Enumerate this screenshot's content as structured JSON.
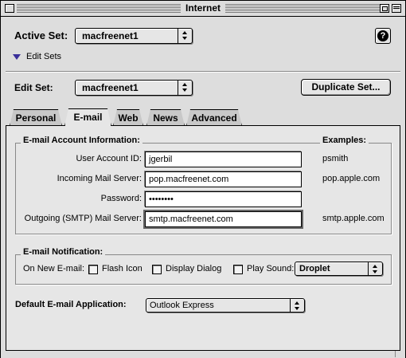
{
  "window": {
    "title": "Internet"
  },
  "header": {
    "active_set_label": "Active Set:",
    "active_set_value": "macfreenet1",
    "edit_sets_label": "Edit Sets",
    "edit_set_label": "Edit Set:",
    "edit_set_value": "macfreenet1",
    "duplicate_button": "Duplicate Set...",
    "help_icon": "?"
  },
  "tabs": [
    {
      "label": "Personal",
      "active": false
    },
    {
      "label": "E-mail",
      "active": true
    },
    {
      "label": "Web",
      "active": false
    },
    {
      "label": "News",
      "active": false
    },
    {
      "label": "Advanced",
      "active": false
    }
  ],
  "account": {
    "group_title": "E-mail Account Information:",
    "examples_title": "Examples:",
    "fields": [
      {
        "label": "User Account ID:",
        "value": "jgerbil",
        "example": "psmith"
      },
      {
        "label": "Incoming Mail Server:",
        "value": "pop.macfreenet.com",
        "example": "pop.apple.com"
      },
      {
        "label": "Password:",
        "value": "••••••••",
        "example": ""
      },
      {
        "label": "Outgoing (SMTP) Mail Server:",
        "value": "smtp.macfreenet.com",
        "example": "smtp.apple.com"
      }
    ]
  },
  "notification": {
    "group_title": "E-mail Notification:",
    "on_new_label": "On New E-mail:",
    "flash_icon": "Flash Icon",
    "display_dialog": "Display Dialog",
    "play_sound": "Play Sound:",
    "sound_value": "Droplet"
  },
  "default_app": {
    "label": "Default E-mail Application:",
    "value": "Outlook Express"
  },
  "icons": [
    "close-box-icon",
    "zoom-box-icon",
    "collapse-box-icon",
    "help-icon",
    "disclosure-triangle-icon",
    "popup-arrows-icon"
  ]
}
